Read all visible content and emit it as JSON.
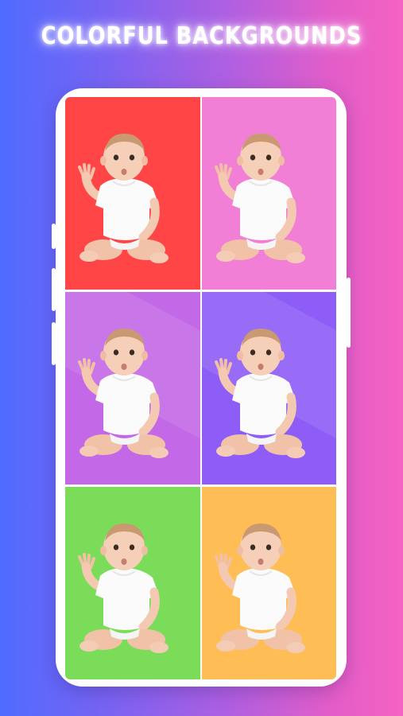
{
  "headline": "COLORFUL BACKGROUNDS",
  "colors": {
    "page_gradient": [
      "#4f6bff",
      "#b25fe0",
      "#f562c2"
    ],
    "phone_frame": "#ffffff"
  },
  "tiles": [
    {
      "label": "red-background",
      "color": "#ff4545",
      "icon": "baby-photo"
    },
    {
      "label": "pink-background",
      "color": "#f27fd6",
      "icon": "baby-photo"
    },
    {
      "label": "violet-background",
      "color": "#c368e6",
      "icon": "baby-photo"
    },
    {
      "label": "purple-background",
      "color": "#8e5cf7",
      "icon": "baby-photo"
    },
    {
      "label": "green-background",
      "color": "#7bdc5a",
      "icon": "baby-photo"
    },
    {
      "label": "orange-background",
      "color": "#ffbe55",
      "icon": "baby-photo"
    }
  ]
}
